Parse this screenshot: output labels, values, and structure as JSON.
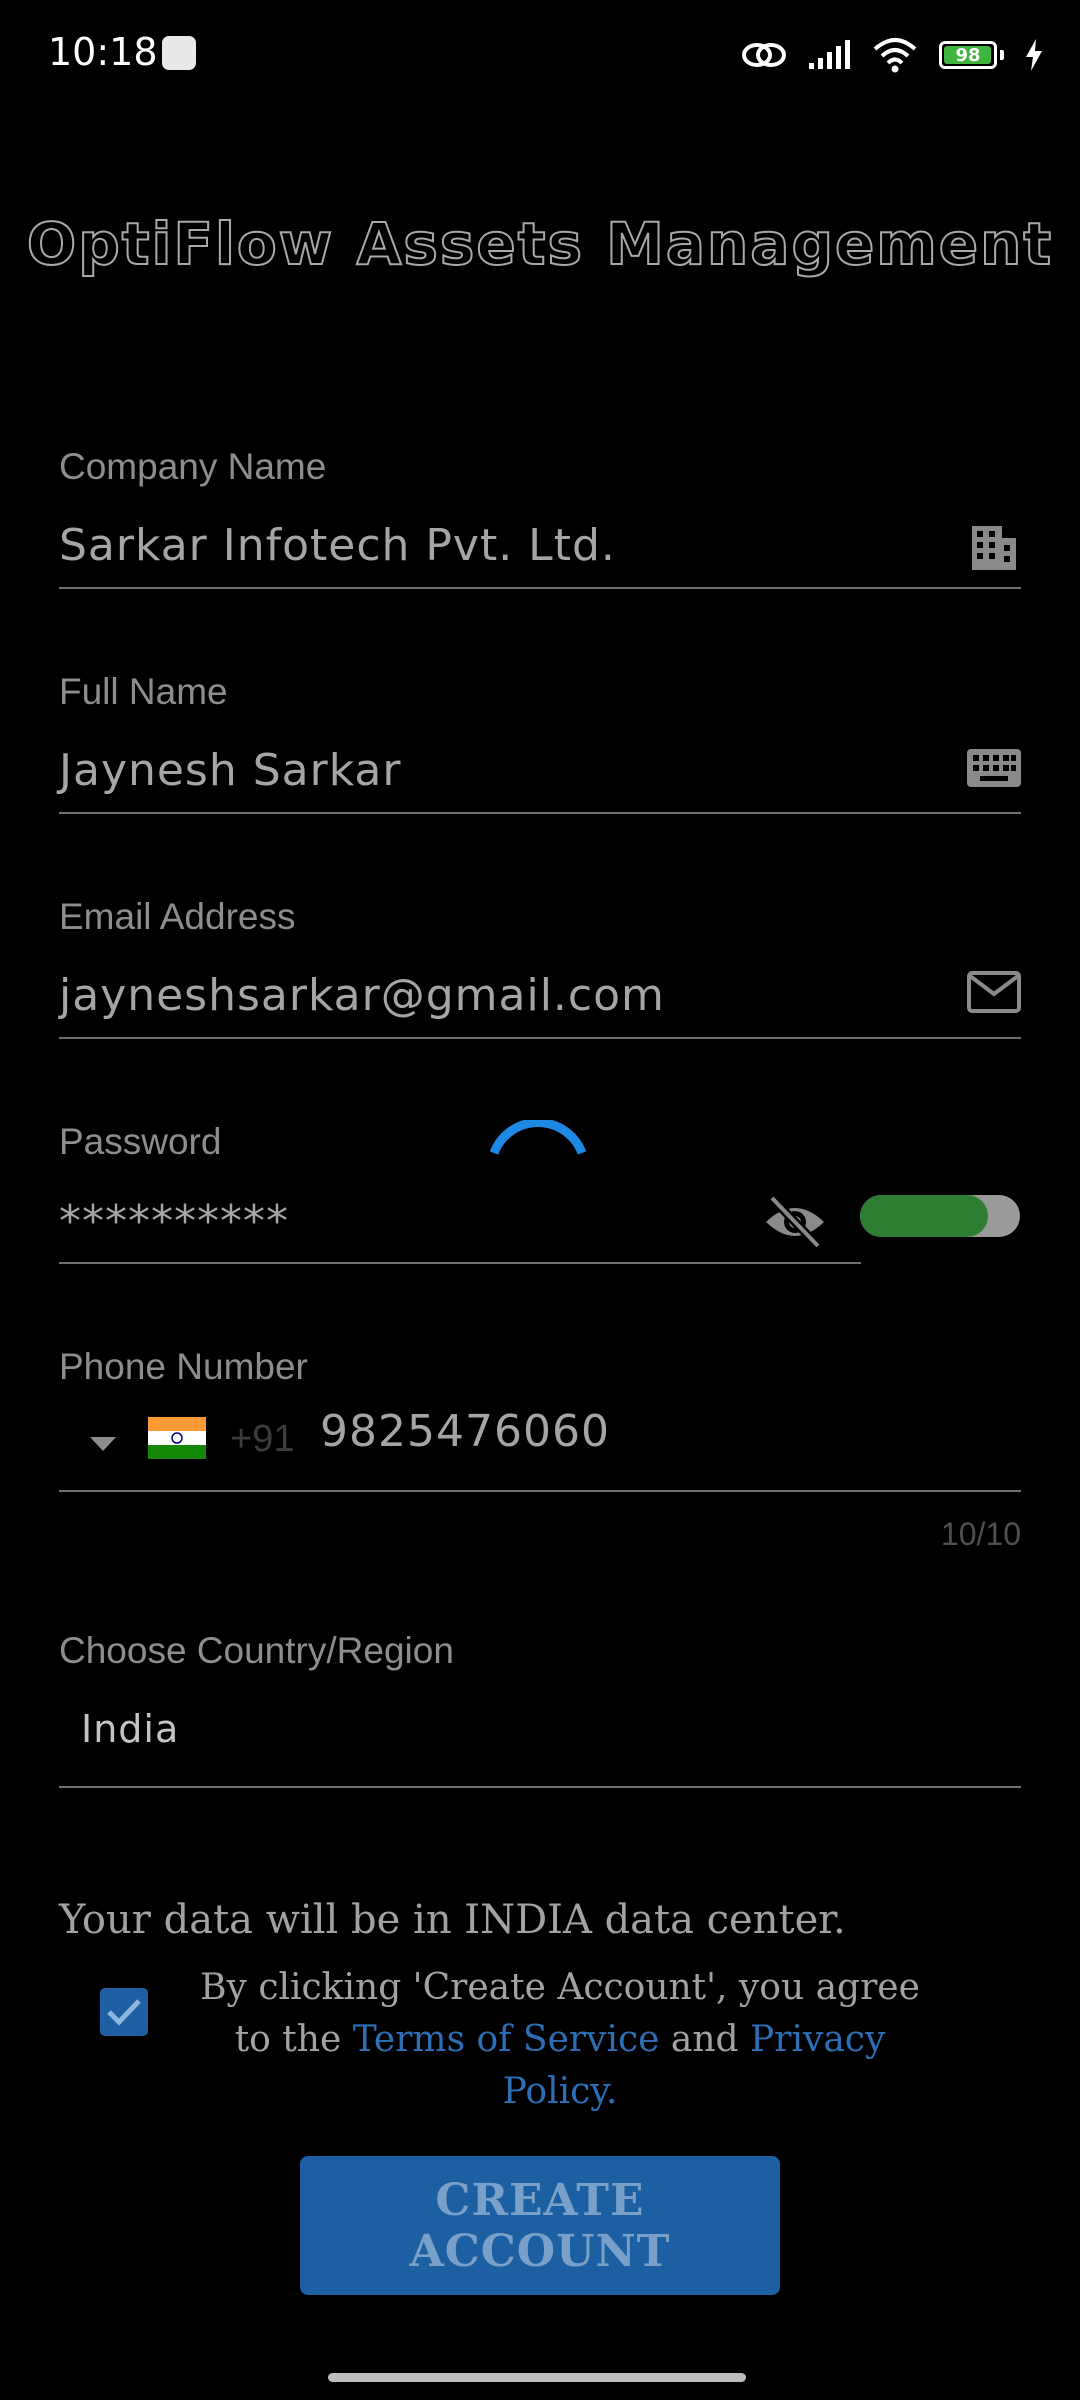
{
  "status_bar": {
    "time": "10:18",
    "battery_level": "98",
    "battery_fraction": 0.98,
    "icons": [
      "link-icon",
      "signal-icon",
      "wifi-icon",
      "battery-icon",
      "charging-icon"
    ]
  },
  "app": {
    "title": "OptiFlow Assets Management"
  },
  "form": {
    "company": {
      "label": "Company Name",
      "value": "Sarkar Infotech Pvt. Ltd.",
      "icon": "building-icon"
    },
    "full_name": {
      "label": "Full Name",
      "value": "Jaynesh Sarkar",
      "icon": "keyboard-icon"
    },
    "email": {
      "label": "Email Address",
      "value": "jayneshsarkar@gmail.com",
      "icon": "mail-icon"
    },
    "password": {
      "label": "Password",
      "value": "**********",
      "icon": "eye-off-icon",
      "strength_fraction": 0.8
    },
    "phone": {
      "label": "Phone Number",
      "country_prefix": "+91",
      "value": "9825476060",
      "counter": "10/10",
      "flag": "india-flag-icon"
    },
    "country": {
      "label": "Choose Country/Region",
      "value": "India"
    }
  },
  "data_center_notice": "Your data will be in INDIA data center.",
  "terms": {
    "checked": true,
    "prefix": "By clicking 'Create Account', you agree to the ",
    "tos_link": "Terms of Service",
    "and": " and ",
    "privacy_link": "Privacy Policy."
  },
  "create_button": "CREATE ACCOUNT",
  "colors": {
    "accent": "#1c5fa3",
    "link": "#2d6fb6",
    "toggle_on": "#2e7d32",
    "spinner": "#1e88e5",
    "background": "#000000"
  }
}
